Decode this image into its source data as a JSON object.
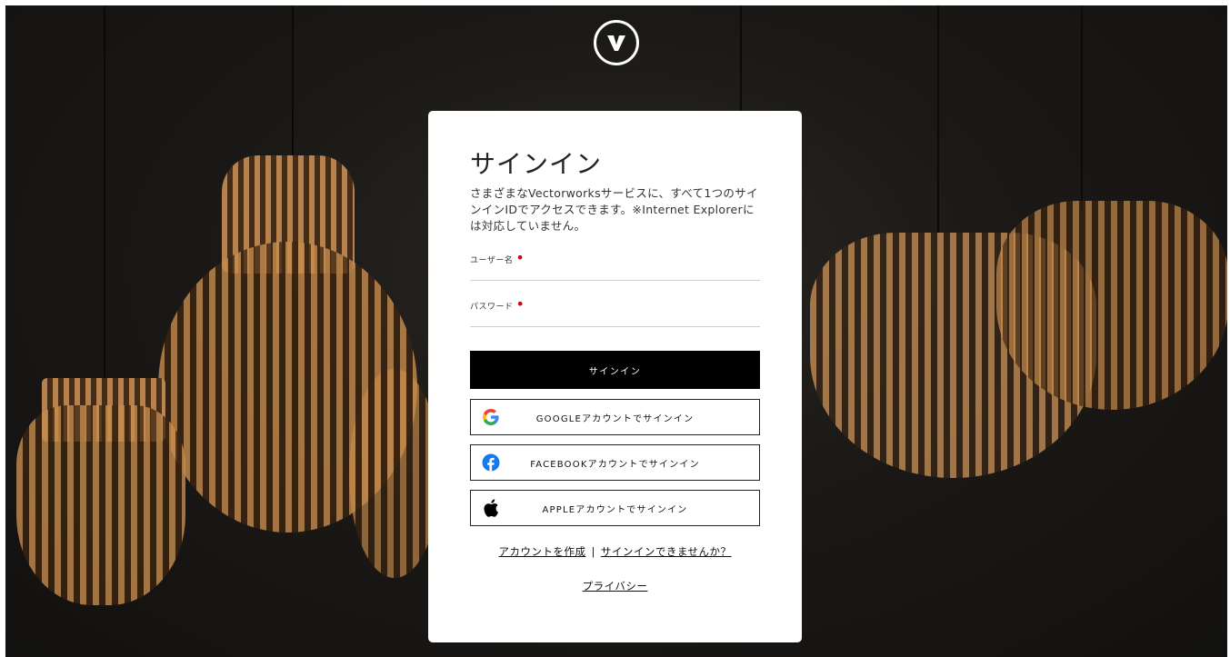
{
  "brand": {
    "logo_icon": "vectorworks-logo-icon"
  },
  "signin": {
    "title": "サインイン",
    "description": "さまざまなVectorworksサービスに、すべて1つのサインインIDでアクセスできます。※Internet Explorerには対応していません。",
    "username_label": "ユーザー名",
    "password_label": "パスワード",
    "required_mark": "•",
    "username_value": "",
    "password_value": "",
    "submit_label": "サインイン"
  },
  "social": [
    {
      "label": "GOOGLEアカウントでサインイン",
      "icon": "google-icon"
    },
    {
      "label": "FACEBOOKアカウントでサインイン",
      "icon": "facebook-icon"
    },
    {
      "label": "APPLEアカウントでサインイン",
      "icon": "apple-icon"
    }
  ],
  "links": {
    "create_account": "アカウントを作成",
    "separator": "|",
    "cannot_signin": "サインインできませんか？",
    "privacy": "プライバシー"
  },
  "colors": {
    "primary_button": "#000000",
    "required": "#d0021b",
    "facebook": "#1877F2"
  }
}
